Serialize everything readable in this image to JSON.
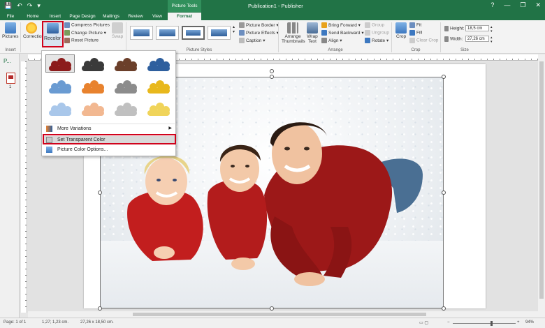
{
  "window": {
    "title": "Publication1 - Publisher",
    "context_tab_header": "Picture Tools",
    "qat": [
      "💾",
      "↶",
      "↷",
      "▾"
    ],
    "controls": [
      "?",
      "—",
      "❐",
      "✕"
    ]
  },
  "tabs": [
    "File",
    "Home",
    "Insert",
    "Page Design",
    "Mailings",
    "Review",
    "View",
    "Format"
  ],
  "ribbon": {
    "insert_group": {
      "pictures": "Pictures",
      "label": "Insert"
    },
    "adjust_group": {
      "corrections": "Corrections",
      "recolor": "Recolor",
      "compress": "Compress Pictures",
      "change": "Change Picture",
      "reset": "Reset Picture",
      "swap": "Swap"
    },
    "picture_styles": {
      "label": "Picture Styles",
      "border": "Picture Border",
      "effects": "Picture Effects",
      "caption": "Caption"
    },
    "arrange_group": {
      "label": "Arrange",
      "arrange_thumbnails": "Arrange Thumbnails",
      "wrap_text": "Wrap Text",
      "bring_forward": "Bring Forward",
      "send_backward": "Send Backward",
      "align": "Align",
      "group": "Group",
      "ungroup": "Ungroup",
      "rotate": "Rotate"
    },
    "crop_group": {
      "label": "Crop",
      "crop": "Crop",
      "fit": "Fit",
      "fill": "Fill",
      "clear_crop": "Clear Crop"
    },
    "size_group": {
      "label": "Size",
      "height_label": "Height:",
      "height_value": "18,5 cm",
      "width_label": "Width:",
      "width_value": "27,26 cm"
    }
  },
  "pages_pane": {
    "label": "P...",
    "page_number": "1"
  },
  "recolor_menu": {
    "swatch_colors": [
      [
        "#8c1c1c",
        "#3a3a3a",
        "#6b3f2a",
        "#2e5f9e"
      ],
      [
        "#6a9bd2",
        "#e8822e",
        "#8c8c8c",
        "#e8b81c"
      ],
      [
        "#a9c7ea",
        "#f2b891",
        "#c0c0c0",
        "#f0d45a"
      ]
    ],
    "more_variations": "More Variations",
    "set_transparent": "Set Transparent Color",
    "picture_color_options": "Picture Color Options..."
  },
  "status_bar": {
    "page": "Page: 1 of 1",
    "position": "1,27; 1,23 cm.",
    "size": "27,26 x 18,50 cm.",
    "zoom": "94%"
  },
  "colors": {
    "brand": "#217346",
    "highlight": "#d0021b"
  }
}
